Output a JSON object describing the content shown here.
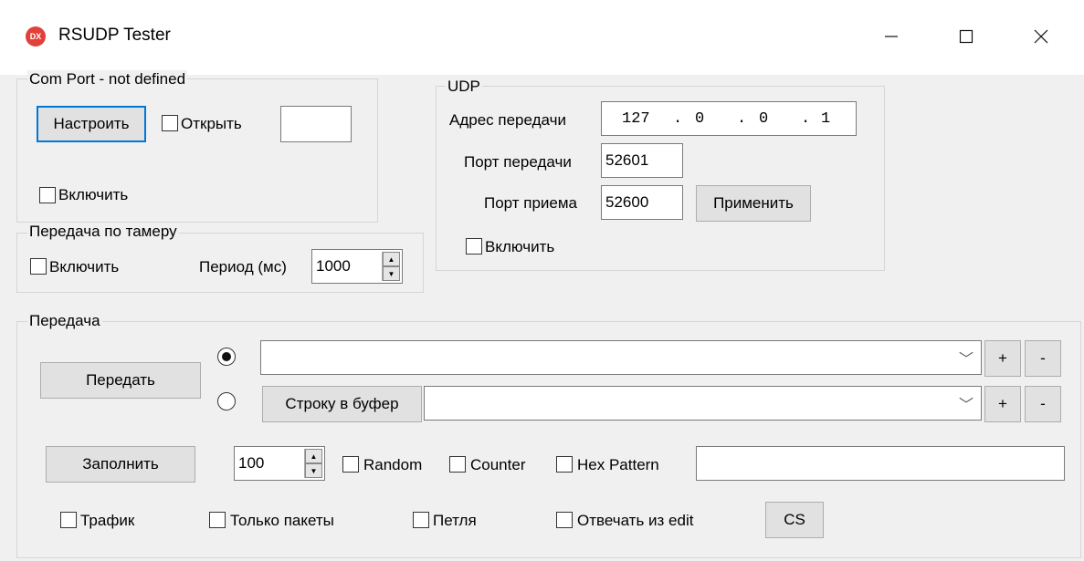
{
  "window": {
    "title": "RSUDP Tester",
    "icon_text": "DX"
  },
  "com_port": {
    "legend": "Com Port - not defined",
    "configure_button": "Настроить",
    "open_label": "Открыть",
    "enable_label": "Включить"
  },
  "timer": {
    "legend": "Передача по тамеру",
    "enable_label": "Включить",
    "period_label": "Период (мс)",
    "period_value": "1000"
  },
  "udp": {
    "legend": "UDP",
    "address_label": "Адрес передачи",
    "address_octets": [
      "127",
      "0",
      "0",
      "1"
    ],
    "send_port_label": "Порт передачи",
    "send_port_value": "52601",
    "recv_port_label": "Порт приема",
    "recv_port_value": "52600",
    "apply_button": "Применить",
    "enable_label": "Включить"
  },
  "transmit": {
    "legend": "Передача",
    "send_button": "Передать",
    "to_buffer_button": "Строку в буфер",
    "plus": "+",
    "minus": "-",
    "fill_button": "Заполнить",
    "fill_count": "100",
    "random_label": "Random",
    "counter_label": "Counter",
    "hex_pattern_label": "Hex Pattern",
    "traffic_label": "Трафик",
    "packets_only_label": "Только пакеты",
    "loop_label": "Петля",
    "reply_from_edit_label": "Отвечать из edit",
    "cs_button": "CS"
  }
}
